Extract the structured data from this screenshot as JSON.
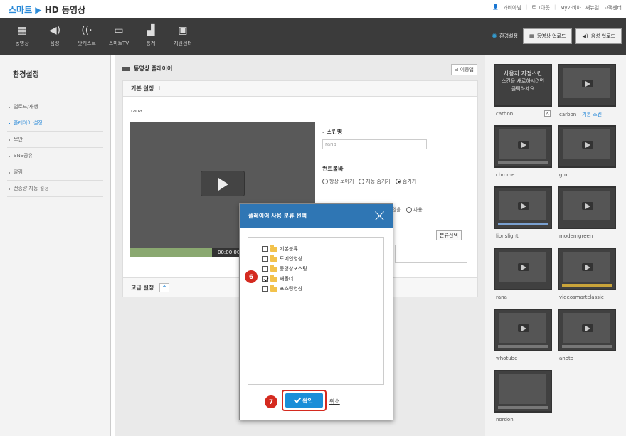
{
  "header": {
    "logo_part1": "스마트",
    "logo_part2": "HD 동영상",
    "user": "가비아님",
    "links": [
      "로그아웃",
      "My가비아",
      "새뉴얼",
      "고객센터"
    ]
  },
  "nav": {
    "items": [
      {
        "label": "동영상",
        "icon": "film-icon"
      },
      {
        "label": "음성",
        "icon": "speaker-icon"
      },
      {
        "label": "팟캐스트",
        "icon": "wifi-icon"
      },
      {
        "label": "스마트TV",
        "icon": "tv-icon"
      },
      {
        "label": "통계",
        "icon": "chart-icon"
      },
      {
        "label": "지원센터",
        "icon": "monitor-icon"
      }
    ],
    "settings_label": "환경설정",
    "upload_video": "동영상 업로드",
    "upload_audio": "음성 업로드"
  },
  "sidebar": {
    "title": "환경설정",
    "items": [
      "업로드/재생",
      "플레이어 설정",
      "보안",
      "SNS공유",
      "알림",
      "전송량 자동 설정"
    ]
  },
  "main": {
    "title": "동영상 플레이어",
    "moveup_label": "이동업",
    "basic_title": "기본 설정",
    "info_icon": "i",
    "skin_name": "rana",
    "player_time": "00:00 00",
    "skin_label": "- 스킨명",
    "skin_input_value": "rana",
    "controlbar_label": "컨트롤바",
    "controlbar_options": [
      "항상 보이기",
      "자동 숨기기",
      "숨기기"
    ],
    "second_row_options": [
      "사용하지 않음",
      "사용"
    ],
    "category_btn": "분류선택",
    "advanced_title": "고급 설정",
    "advanced_toggle": "^"
  },
  "skins": [
    {
      "name": "carbon",
      "selected": false
    },
    {
      "name": "carbon",
      "suffix": " – 기본 스킨",
      "selected": false
    },
    {
      "name": "chrome"
    },
    {
      "name": "grol"
    },
    {
      "name": "lionslight"
    },
    {
      "name": "moderngreen"
    },
    {
      "name": "rana",
      "selected": true
    },
    {
      "name": "videosmartclassic"
    },
    {
      "name": "whotube"
    },
    {
      "name": "anoto"
    },
    {
      "name": "nordon"
    }
  ],
  "skin_overlay": {
    "title": "사용자 지정스킨",
    "text": "스킨을 새로하시려면 클릭하세요"
  },
  "modal": {
    "title": "플레이어 사용 분류 선택",
    "folders": [
      {
        "label": "기본분류",
        "checked": false
      },
      {
        "label": "도메인영상",
        "checked": false
      },
      {
        "label": "동영상포스팅",
        "checked": false
      },
      {
        "label": "새폴더",
        "checked": true
      },
      {
        "label": "포스팅영상",
        "checked": false
      }
    ],
    "ok_label": "확인",
    "cancel_label": "취소",
    "step_badges": [
      "6",
      "7"
    ]
  }
}
